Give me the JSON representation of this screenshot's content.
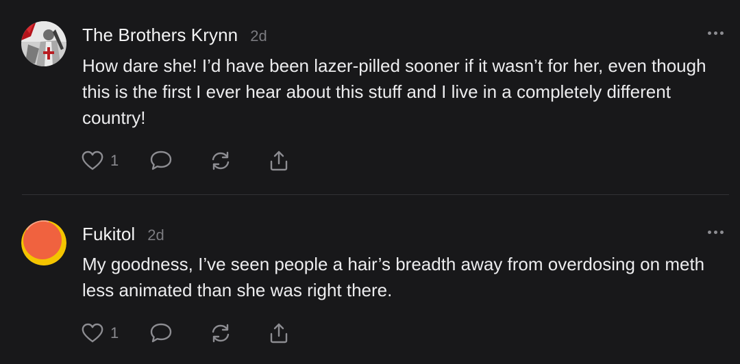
{
  "comments": [
    {
      "author": "The Brothers Krynn",
      "time": "2d",
      "text": "How dare she! I’d have been lazer-pilled sooner if it wasn’t for her, even though this is the first I ever hear about this stuff and I live in a completely different country!",
      "like_count": "1"
    },
    {
      "author": "Fukitol",
      "time": "2d",
      "text": "My goodness, I’ve seen people a hair’s breadth away from overdosing on meth less animated than she was right there.",
      "like_count": "1"
    }
  ],
  "icons": [
    "heart-icon",
    "comment-icon",
    "restack-icon",
    "share-icon",
    "more-icon"
  ],
  "colors": {
    "background": "#18181a",
    "text": "#ececee",
    "muted": "#7b7b80",
    "icon": "#8d8d92",
    "divider": "#323236"
  }
}
